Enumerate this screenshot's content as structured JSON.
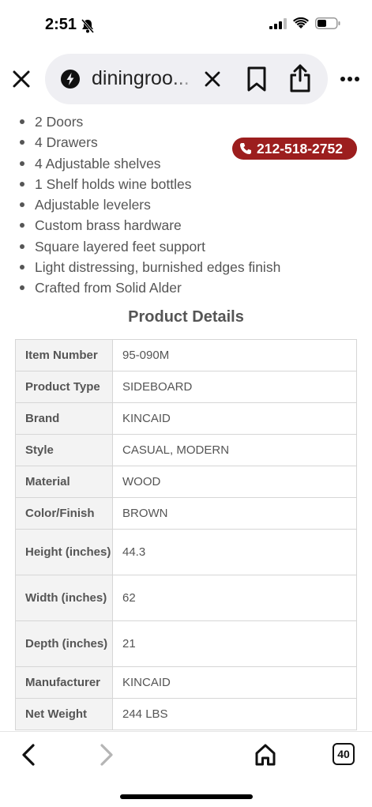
{
  "status": {
    "time": "2:51"
  },
  "browser": {
    "url": "diningroo...",
    "icons": [
      "close-icon",
      "site-icon",
      "clear-icon",
      "bookmark-icon",
      "share-icon",
      "more-icon"
    ]
  },
  "features": [
    "2 Doors",
    "4 Drawers",
    "4 Adjustable shelves",
    "1 Shelf holds wine bottles",
    "Adjustable levelers",
    "Custom brass hardware",
    "Square layered feet support",
    "Light distressing, burnished edges finish",
    "Crafted from Solid Alder"
  ],
  "phone": {
    "number": "212-518-2752",
    "color": "#9c1e1e"
  },
  "details": {
    "title": "Product Details",
    "rows": [
      {
        "label": "Item Number",
        "value": "95-090M"
      },
      {
        "label": "Product Type",
        "value": "SIDEBOARD"
      },
      {
        "label": "Brand",
        "value": "KINCAID"
      },
      {
        "label": "Style",
        "value": "CASUAL, MODERN"
      },
      {
        "label": "Material",
        "value": "WOOD"
      },
      {
        "label": "Color/Finish",
        "value": "BROWN"
      },
      {
        "label": "Height (inches)",
        "value": "44.3"
      },
      {
        "label": "Width (inches)",
        "value": "62"
      },
      {
        "label": "Depth (inches)",
        "value": "21"
      },
      {
        "label": "Manufacturer",
        "value": "KINCAID"
      },
      {
        "label": "Net Weight",
        "value": "244 LBS"
      }
    ]
  },
  "toolbar": {
    "tab_count": "40"
  }
}
